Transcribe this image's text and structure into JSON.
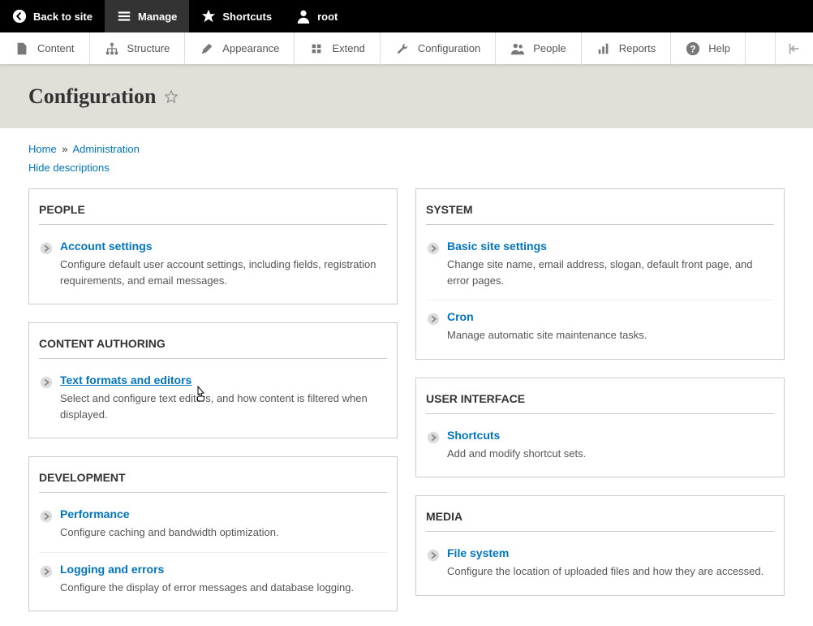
{
  "toolbar": {
    "back": "Back to site",
    "manage": "Manage",
    "shortcuts": "Shortcuts",
    "user": "root"
  },
  "adminMenu": {
    "content": "Content",
    "structure": "Structure",
    "appearance": "Appearance",
    "extend": "Extend",
    "configuration": "Configuration",
    "people": "People",
    "reports": "Reports",
    "help": "Help"
  },
  "pageTitle": "Configuration",
  "breadcrumb": {
    "home": "Home",
    "admin": "Administration"
  },
  "hideDescriptions": "Hide descriptions",
  "sections": {
    "people": {
      "title": "People",
      "items": [
        {
          "label": "Account settings",
          "desc": "Configure default user account settings, including fields, registration requirements, and email messages."
        }
      ]
    },
    "contentAuthoring": {
      "title": "Content Authoring",
      "items": [
        {
          "label": "Text formats and editors",
          "desc": "Select and configure text editors, and how content is filtered when displayed."
        }
      ]
    },
    "development": {
      "title": "Development",
      "items": [
        {
          "label": "Performance",
          "desc": "Configure caching and bandwidth optimization."
        },
        {
          "label": "Logging and errors",
          "desc": "Configure the display of error messages and database logging."
        }
      ]
    },
    "system": {
      "title": "System",
      "items": [
        {
          "label": "Basic site settings",
          "desc": "Change site name, email address, slogan, default front page, and error pages."
        },
        {
          "label": "Cron",
          "desc": "Manage automatic site maintenance tasks."
        }
      ]
    },
    "userInterface": {
      "title": "User Interface",
      "items": [
        {
          "label": "Shortcuts",
          "desc": "Add and modify shortcut sets."
        }
      ]
    },
    "media": {
      "title": "Media",
      "items": [
        {
          "label": "File system",
          "desc": "Configure the location of uploaded files and how they are accessed."
        }
      ]
    }
  }
}
